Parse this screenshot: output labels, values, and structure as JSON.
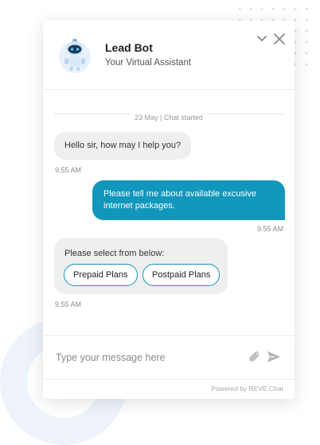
{
  "header": {
    "title": "Lead Bot",
    "subtitle": "Your Virtual Assistant"
  },
  "chat": {
    "divider": "23 May | Chat started",
    "messages": [
      {
        "from": "bot",
        "text": "Hello sir, how may I help you?",
        "time": "9.55 AM"
      },
      {
        "from": "user",
        "text": "Please tell me about available excusive internet packages.",
        "time": "9.55 AM"
      },
      {
        "from": "bot",
        "text": "Please select from below:",
        "time": "9.55 AM",
        "options": [
          "Prepaid Plans",
          "Postpaid Plans"
        ]
      }
    ]
  },
  "composer": {
    "placeholder": "Type your message here"
  },
  "footer": {
    "text": "Powered by REVE Chat"
  },
  "colors": {
    "accent": "#1197bb",
    "bot_bubble": "#efefef"
  },
  "icons": [
    "bot-avatar-icon",
    "chevron-down-icon",
    "close-icon",
    "paperclip-icon",
    "send-icon"
  ]
}
